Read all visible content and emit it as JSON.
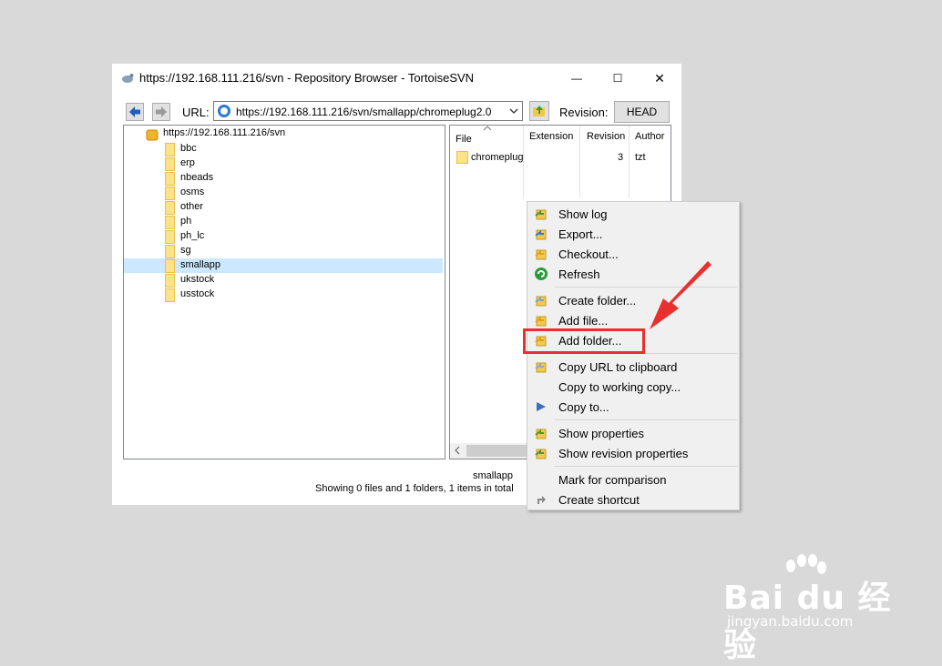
{
  "window": {
    "title": "https://192.168.111.216/svn - Repository Browser - TortoiseSVN",
    "controls": {
      "minimize": "—",
      "maximize": "☐",
      "close": "✕"
    }
  },
  "toolbar": {
    "url_label": "URL:",
    "url_value": "https://192.168.111.216/svn/smallapp/chromeplug2.0",
    "revision_label": "Revision:",
    "revision_button": "HEAD"
  },
  "tree": {
    "root": "https://192.168.111.216/svn",
    "items": [
      {
        "label": "bbc"
      },
      {
        "label": "erp"
      },
      {
        "label": "nbeads"
      },
      {
        "label": "osms"
      },
      {
        "label": "other"
      },
      {
        "label": "ph"
      },
      {
        "label": "ph_lc"
      },
      {
        "label": "sg"
      },
      {
        "label": "smallapp"
      },
      {
        "label": "ukstock"
      },
      {
        "label": "usstock"
      }
    ],
    "selected": "smallapp"
  },
  "files": {
    "columns": [
      "File",
      "Extension",
      "Revision",
      "Author"
    ],
    "rows": [
      {
        "file": "chromeplug",
        "extension": "",
        "revision": "3",
        "author": "tzt"
      }
    ]
  },
  "status": {
    "line1": "smallapp",
    "line2": "Showing 0 files and 1 folders, 1 items in total"
  },
  "context_menu": {
    "groups": [
      [
        {
          "label": "Show log",
          "icon": "show-log-icon"
        },
        {
          "label": "Export...",
          "icon": "export-icon"
        },
        {
          "label": "Checkout...",
          "icon": "checkout-icon"
        },
        {
          "label": "Refresh",
          "icon": "refresh-icon"
        }
      ],
      [
        {
          "label": "Create folder...",
          "icon": "create-folder-icon"
        },
        {
          "label": "Add file...",
          "icon": "add-file-icon"
        },
        {
          "label": "Add folder...",
          "icon": "add-folder-icon"
        }
      ],
      [
        {
          "label": "Copy URL to clipboard",
          "icon": "copy-url-icon"
        },
        {
          "label": "Copy to working copy...",
          "icon": ""
        },
        {
          "label": "Copy to...",
          "icon": "copy-to-icon"
        }
      ],
      [
        {
          "label": "Show properties",
          "icon": "show-properties-icon"
        },
        {
          "label": "Show revision properties",
          "icon": "show-revision-properties-icon"
        }
      ],
      [
        {
          "label": "Mark for comparison",
          "icon": ""
        },
        {
          "label": "Create shortcut",
          "icon": "create-shortcut-icon"
        }
      ]
    ],
    "highlighted": "Add folder..."
  },
  "watermark": {
    "logo": "Bai du 经验",
    "url": "jingyan.baidu.com"
  },
  "colors": {
    "highlight_box": "#e8302e",
    "selection": "#cce8ff",
    "folder": "#fce38a"
  }
}
